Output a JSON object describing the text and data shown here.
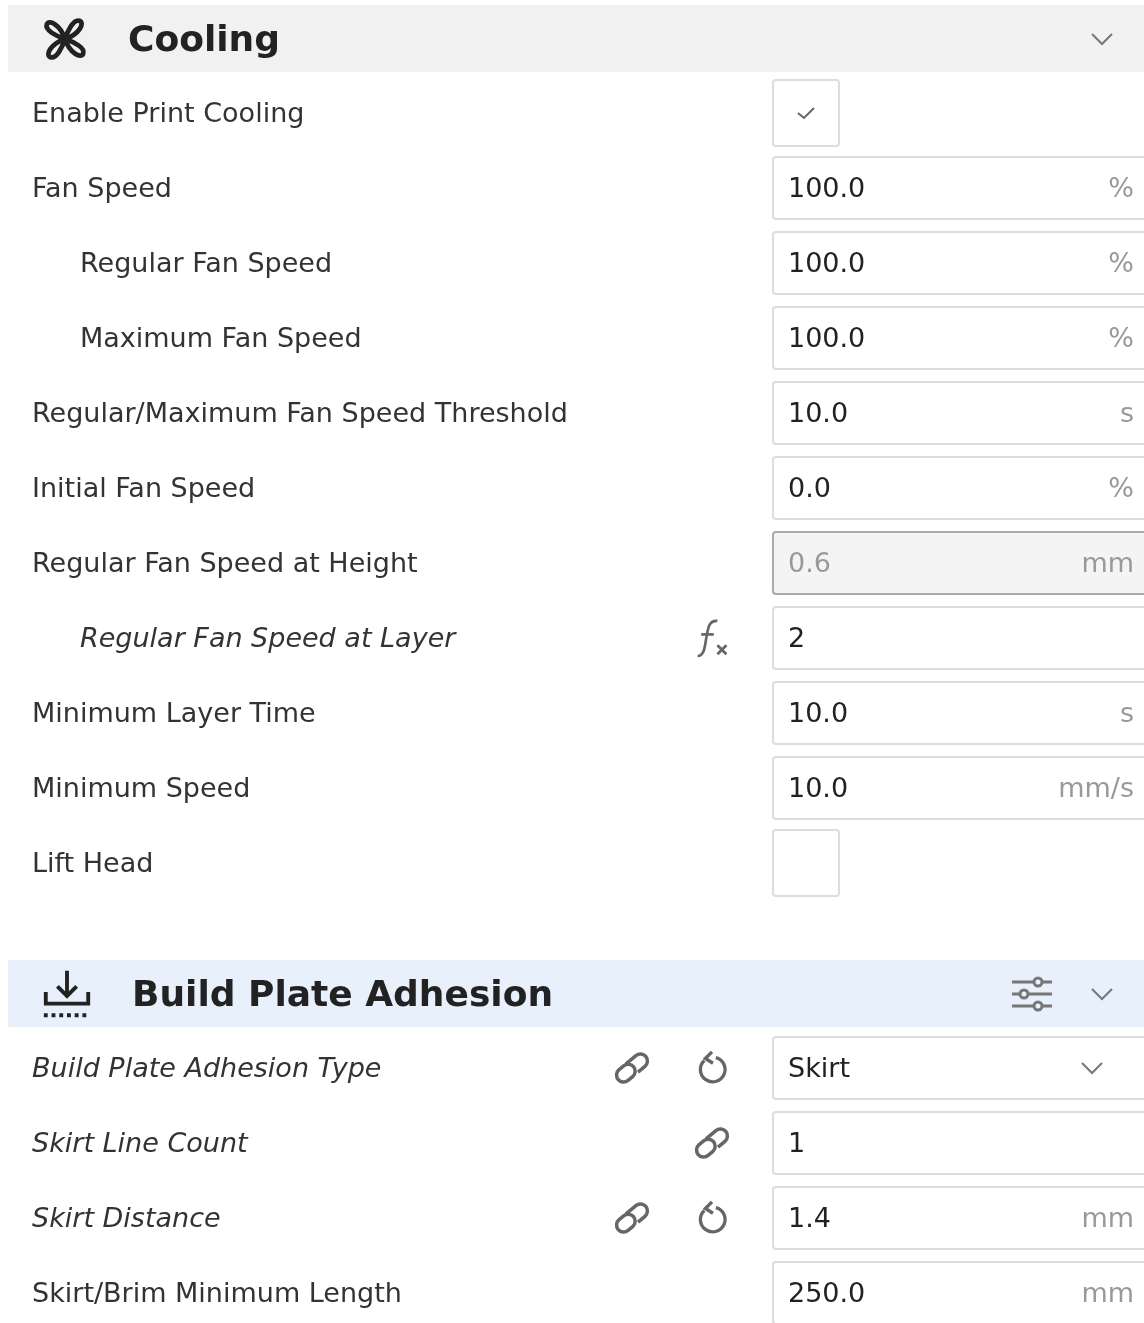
{
  "sections": [
    {
      "kind": "cooling",
      "title": "Cooling",
      "highlighted": false,
      "settings": [
        {
          "label": "Enable Print Cooling",
          "kind": "checkbox",
          "checked": true,
          "overridden": false
        },
        {
          "label": "Fan Speed",
          "kind": "field",
          "value": "100.0",
          "unit": "%",
          "overridden": false,
          "disabled": false,
          "children": [
            {
              "label": "Regular Fan Speed",
              "kind": "field",
              "value": "100.0",
              "unit": "%",
              "overridden": false,
              "disabled": false
            },
            {
              "label": "Maximum Fan Speed",
              "kind": "field",
              "value": "100.0",
              "unit": "%",
              "overridden": false,
              "disabled": false
            }
          ]
        },
        {
          "label": "Regular/Maximum Fan Speed Threshold",
          "kind": "field",
          "value": "10.0",
          "unit": "s",
          "overridden": false,
          "disabled": false
        },
        {
          "label": "Initial Fan Speed",
          "kind": "field",
          "value": "0.0",
          "unit": "%",
          "overridden": false,
          "disabled": false
        },
        {
          "label": "Regular Fan Speed at Height",
          "kind": "field",
          "value": "0.6",
          "unit": "mm",
          "overridden": false,
          "disabled": true,
          "children": [
            {
              "label": "Regular Fan Speed at Layer",
              "kind": "field",
              "value": "2",
              "overridden": true,
              "disabled": false,
              "formula": true
            }
          ]
        },
        {
          "label": "Minimum Layer Time",
          "kind": "field",
          "value": "10.0",
          "unit": "s",
          "overridden": false,
          "disabled": false
        },
        {
          "label": "Minimum Speed",
          "kind": "field",
          "value": "10.0",
          "unit": "mm/s",
          "overridden": false,
          "disabled": false
        },
        {
          "label": "Lift Head",
          "kind": "checkbox",
          "checked": false,
          "overridden": false
        }
      ]
    },
    {
      "kind": "adhesion",
      "title": "Build Plate Adhesion",
      "highlighted": true,
      "settings": [
        {
          "label": "Build Plate Adhesion Type",
          "kind": "dropdown",
          "value": "Skirt",
          "overridden": true,
          "linked": true,
          "resettable": true
        },
        {
          "label": "Skirt Line Count",
          "kind": "field",
          "value": "1",
          "overridden": true,
          "disabled": false,
          "linked": true
        },
        {
          "label": "Skirt Distance",
          "kind": "field",
          "value": "1.4",
          "unit": "mm",
          "overridden": true,
          "disabled": false,
          "linked": true,
          "resettable": true
        },
        {
          "label": "Skirt/Brim Minimum Length",
          "kind": "field",
          "value": "250.0",
          "unit": "mm",
          "overridden": false,
          "disabled": false
        }
      ]
    }
  ]
}
